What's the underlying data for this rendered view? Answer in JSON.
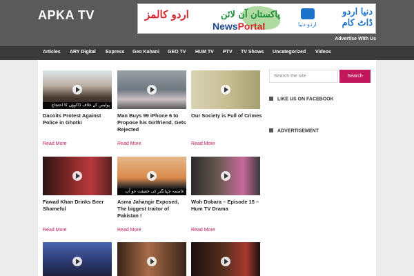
{
  "site": {
    "title": "APKA TV",
    "advertise": "Advertise With Us"
  },
  "banner": {
    "urdu_red": "اردو کالمز",
    "urdu_green": "پاکستان آن لائن",
    "newsportal_a": "News",
    "newsportal_b": "Portal",
    "dunya_small": "اردو دنیا",
    "dunya_big": "دنیا اردو ڈاٹ کام"
  },
  "nav": [
    "Articles",
    "ARY Digital",
    "Express",
    "Geo Kahani",
    "GEO TV",
    "HUM TV",
    "PTV",
    "TV Shows",
    "Uncategorized",
    "Videos"
  ],
  "posts": [
    {
      "title": "Dacoits Protest Against Police in Ghotki",
      "read_more": "Read More",
      "caption": "پولیس کے خلاف ڈاکوؤں کا احتجاج"
    },
    {
      "title": "Man Buys 99 iPhone 6 to Propose his Girlfriend, Gets Rejected",
      "read_more": "Read More"
    },
    {
      "title": "Our Society is Full of Crimes",
      "read_more": "Read More"
    },
    {
      "title": "Fawad Khan Drinks Beer Shameful",
      "read_more": "Read More"
    },
    {
      "title": "Asma Jahangir Exposed, The biggest traitor of Pakistan !",
      "read_more": "Read More",
      "caption": "عاصمہ جہانگیر کی حقیقت جو آپ نہیں جانتے"
    },
    {
      "title": "Woh Dobara – Episode 15 – Hum TV Drama",
      "read_more": "Read More"
    },
    {
      "title": "",
      "read_more": ""
    },
    {
      "title": "",
      "read_more": ""
    },
    {
      "title": "",
      "read_more": ""
    }
  ],
  "sidebar": {
    "search_placeholder": "Search the site",
    "search_button": "Search",
    "facebook_title": "LIKE US ON FACEBOOK",
    "ad_title": "ADVERTISEMENT"
  },
  "colors": {
    "accent": "#c2185b",
    "header_bg": "#5a5a5a",
    "nav_bg": "#3a3a3a"
  }
}
